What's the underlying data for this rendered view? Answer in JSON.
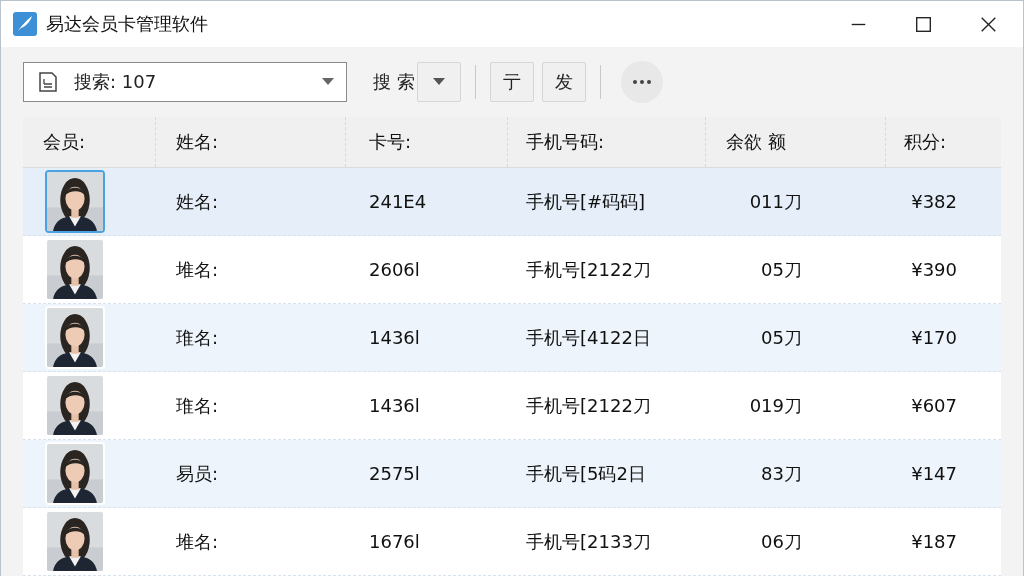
{
  "window": {
    "title": "易达会员卡管理软件"
  },
  "toolbar": {
    "search": {
      "value": "搜索: 107"
    },
    "search_button": "搜 索",
    "buttons": [
      "亍",
      "发"
    ]
  },
  "table": {
    "columns": [
      "会员:",
      "姓名:",
      "卡号:",
      "手机号码:",
      "余欲 额",
      "积分:"
    ],
    "rows": [
      {
        "selected": true,
        "name": "姓名:",
        "card": "241E4",
        "phone": "手机号[#码码]",
        "balance": "011刀",
        "points": "¥382"
      },
      {
        "selected": false,
        "name": "堆名:",
        "card": "2606l",
        "phone": "手机号[2122刀",
        "balance": "05刀",
        "points": "¥390"
      },
      {
        "selected": false,
        "name": "琟名:",
        "card": "1436l",
        "phone": "手机号[4122日",
        "balance": "05刀",
        "points": "¥170"
      },
      {
        "selected": false,
        "name": "琟名:",
        "card": "1436l",
        "phone": "手机号[2122刀",
        "balance": "019刀",
        "points": "¥607"
      },
      {
        "selected": false,
        "name": "易员:",
        "card": "2575l",
        "phone": "手机号[5码2日",
        "balance": "83刀",
        "points": "¥147"
      },
      {
        "selected": false,
        "name": "堆名:",
        "card": "1676l",
        "phone": "手机号[2133刀",
        "balance": "06刀",
        "points": "¥187"
      }
    ]
  }
}
